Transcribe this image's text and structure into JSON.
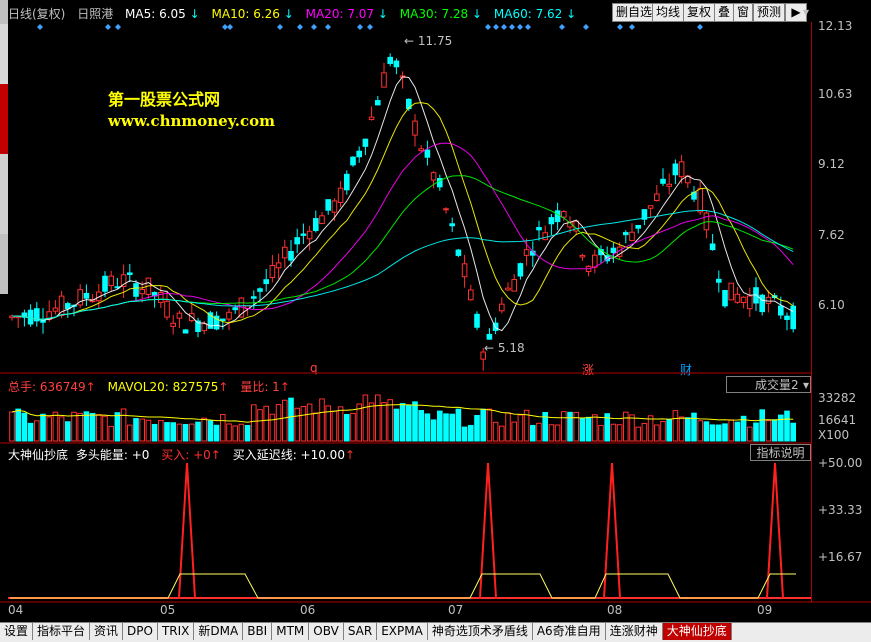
{
  "main_header": {
    "period": "日线(复权)",
    "stock": "日照港",
    "ma": [
      {
        "label": "MA5: 6.05",
        "color": "#ffffff",
        "dir": "down"
      },
      {
        "label": "MA10: 6.26",
        "color": "#ffff00",
        "dir": "down"
      },
      {
        "label": "MA20: 7.07",
        "color": "#ff00ff",
        "dir": "down"
      },
      {
        "label": "MA30: 7.28",
        "color": "#00ff00",
        "dir": "down"
      },
      {
        "label": "MA60: 7.62",
        "color": "#00ffff",
        "dir": "down"
      }
    ]
  },
  "toolbar": [
    "删自选",
    "均线",
    "复权",
    "叠",
    "窗",
    "预测"
  ],
  "watermark": {
    "title": "第一股票公式网",
    "url": "www.chnmoney.com"
  },
  "price_axis": [
    "12.13",
    "10.63",
    "9.12",
    "7.62",
    "6.10"
  ],
  "annotations": {
    "high": "11.75",
    "low": "5.18",
    "marks": [
      "q",
      "涨",
      "财"
    ]
  },
  "volume_header": {
    "total": "总手: 636749",
    "mavol": "MAVOL20: 827575",
    "ratio": "量比: 1",
    "selector": "成交量2"
  },
  "volume_axis": [
    "33282",
    "16641",
    "X100"
  ],
  "indicator_header": {
    "name": "大神仙抄底",
    "bull": "多头能量: +0",
    "buy": "买入: +0",
    "delay": "买入延迟线: +10.00",
    "help_button": "指标说明"
  },
  "indicator_axis": [
    "+50.00",
    "+33.33",
    "+16.67"
  ],
  "date_axis": [
    "04",
    "05",
    "06",
    "07",
    "08",
    "09"
  ],
  "bottom_tabs": [
    "设置",
    "指标平台",
    "资讯",
    "DPO",
    "TRIX",
    "新DMA",
    "BBI",
    "MTM",
    "OBV",
    "SAR",
    "EXPMA",
    "神奇选顶术矛盾线",
    "A6奇准自用",
    "连涨财神",
    "大神仙抄底"
  ],
  "active_tab": "大神仙抄底"
}
